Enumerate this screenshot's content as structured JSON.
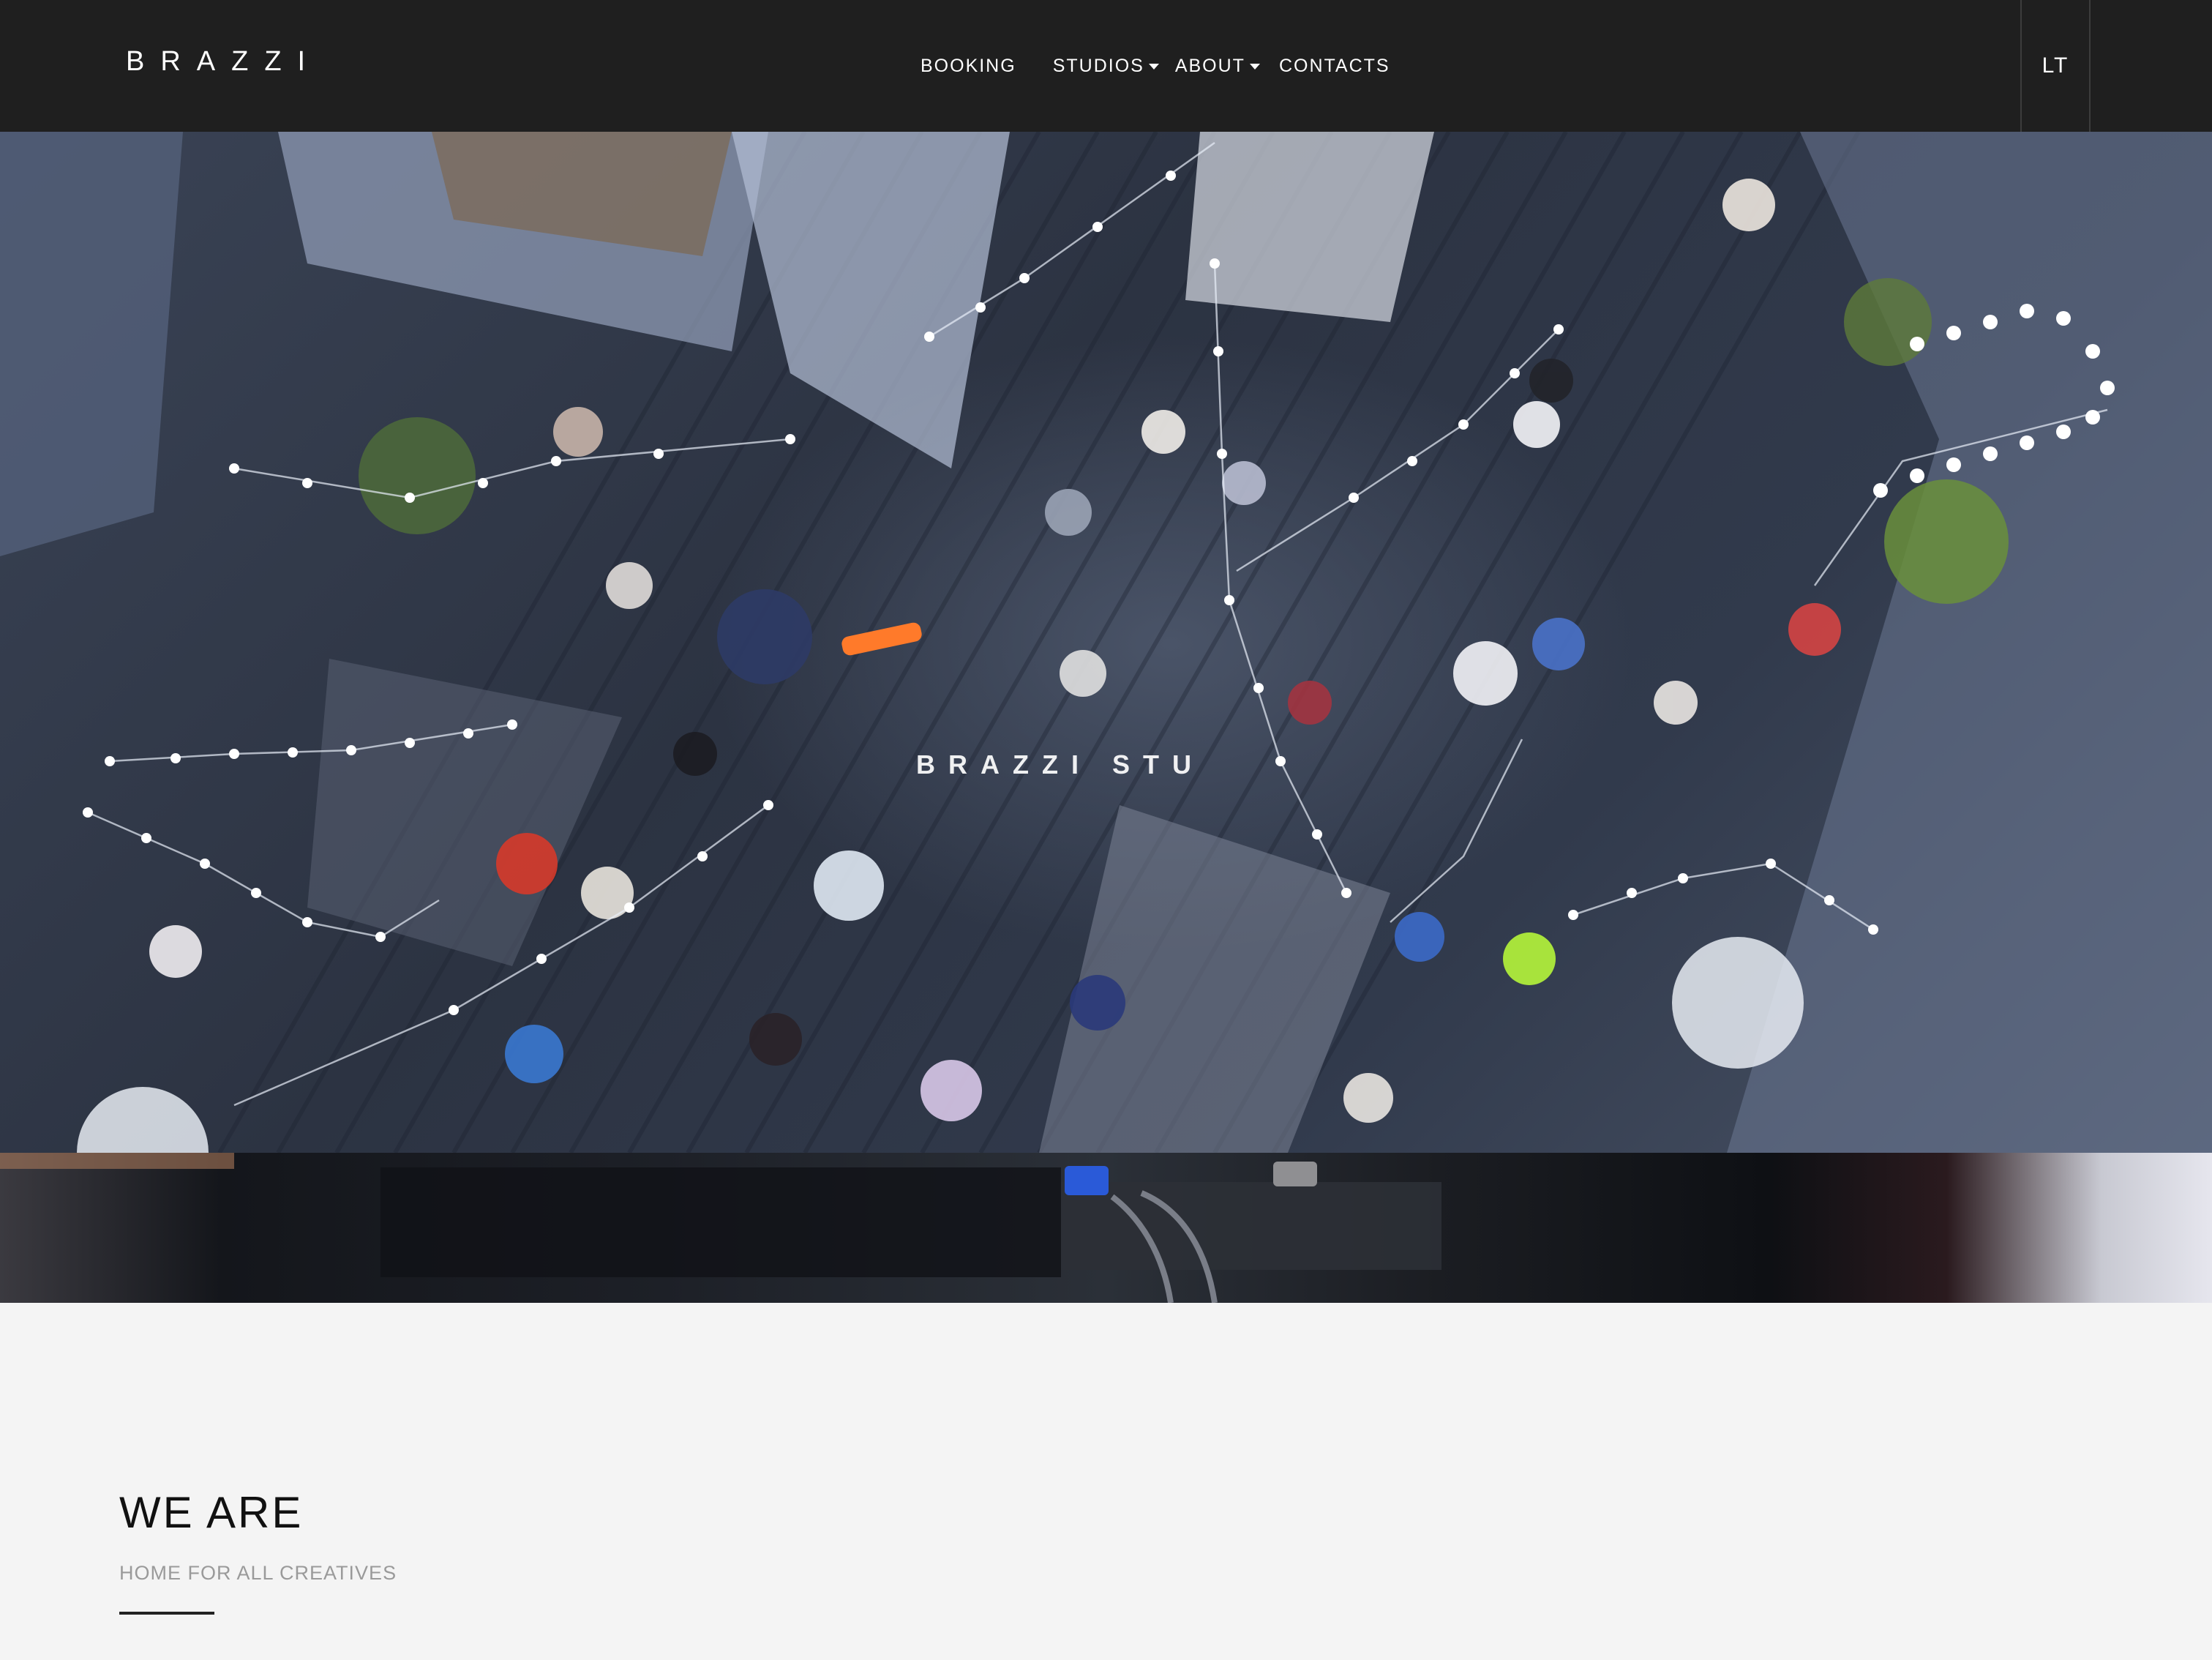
{
  "header": {
    "logo": "BRAZZI",
    "nav": [
      {
        "label": "BOOKING",
        "dropdown": false
      },
      {
        "label": "STUDIOS",
        "dropdown": true
      },
      {
        "label": "ABOUT",
        "dropdown": true
      },
      {
        "label": "CONTACTS",
        "dropdown": false
      }
    ],
    "language": "LT"
  },
  "hero": {
    "overlay_text": "BRAZZI STU",
    "background": "aerial rooftop party video"
  },
  "intro": {
    "heading": "WE ARE",
    "subheading": "HOME FOR ALL CREATIVES"
  },
  "colors": {
    "header_bg": "#1f1f1f",
    "page_bg": "#f4f4f4",
    "accent_dark": "#222222"
  }
}
